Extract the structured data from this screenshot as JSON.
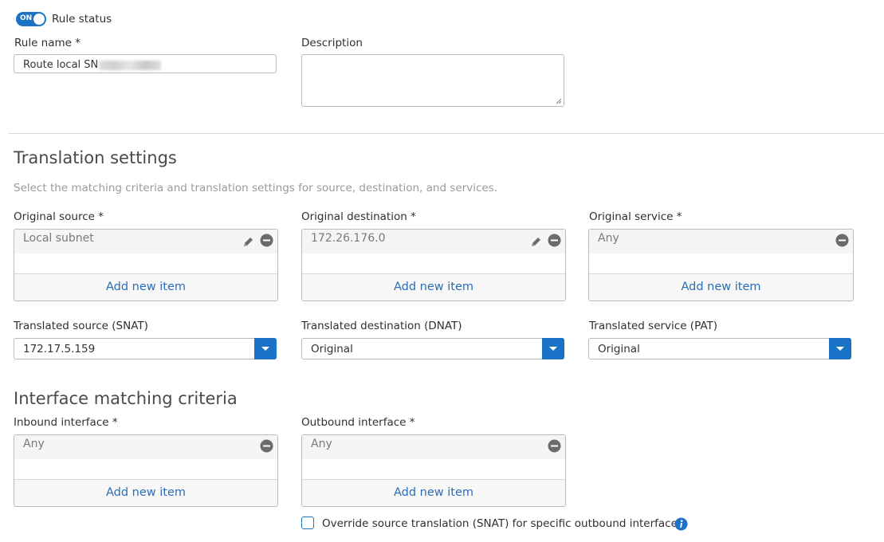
{
  "rule_status": {
    "toggle_text": "ON",
    "label": "Rule status"
  },
  "rule_name": {
    "label": "Rule name *",
    "value": "Route local SN"
  },
  "description": {
    "label": "Description",
    "value": ""
  },
  "translation": {
    "heading": "Translation settings",
    "subtitle": "Select the matching criteria and translation settings for source, destination, and services.",
    "original_source": {
      "label": "Original source *",
      "item": "Local subnet",
      "add_label": "Add new item"
    },
    "original_destination": {
      "label": "Original destination *",
      "item": "172.26.176.0",
      "add_label": "Add new item"
    },
    "original_service": {
      "label": "Original service *",
      "item": "Any",
      "add_label": "Add new item"
    },
    "translated_source": {
      "label": "Translated source (SNAT)",
      "value": "172.17.5.159"
    },
    "translated_destination": {
      "label": "Translated destination (DNAT)",
      "value": "Original"
    },
    "translated_service": {
      "label": "Translated service (PAT)",
      "value": "Original"
    }
  },
  "interface": {
    "heading": "Interface matching criteria",
    "inbound": {
      "label": "Inbound interface *",
      "item": "Any",
      "add_label": "Add new item"
    },
    "outbound": {
      "label": "Outbound interface *",
      "item": "Any",
      "add_label": "Add new item"
    },
    "override_label": "Override source translation (SNAT) for specific outbound interfaces"
  },
  "colors": {
    "accent": "#1a73c7",
    "link": "#2b6db5"
  }
}
